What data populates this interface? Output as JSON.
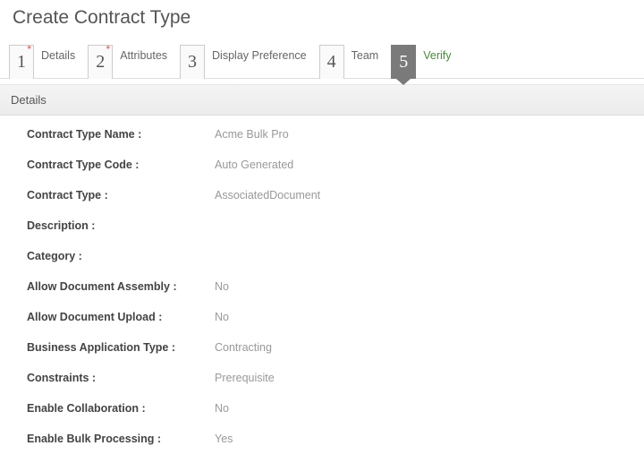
{
  "page": {
    "title": "Create Contract Type"
  },
  "wizard": {
    "active_index": 4,
    "steps": [
      {
        "num": "1",
        "label": "Details",
        "required": true
      },
      {
        "num": "2",
        "label": "Attributes",
        "required": true
      },
      {
        "num": "3",
        "label": "Display Preference",
        "required": false
      },
      {
        "num": "4",
        "label": "Team",
        "required": false
      },
      {
        "num": "5",
        "label": "Verify",
        "required": false
      }
    ]
  },
  "details": {
    "section_title": "Details",
    "rows": [
      {
        "label": "Contract Type Name :",
        "value": "Acme Bulk Pro"
      },
      {
        "label": "Contract Type Code :",
        "value": "Auto Generated"
      },
      {
        "label": "Contract Type :",
        "value": "AssociatedDocument"
      },
      {
        "label": "Description :",
        "value": ""
      },
      {
        "label": "Category :",
        "value": ""
      },
      {
        "label": "Allow Document Assembly :",
        "value": "No"
      },
      {
        "label": "Allow Document Upload :",
        "value": "No"
      },
      {
        "label": "Business Application Type :",
        "value": "Contracting"
      },
      {
        "label": "Constraints :",
        "value": "Prerequisite"
      },
      {
        "label": "Enable Collaboration :",
        "value": "No"
      },
      {
        "label": "Enable Bulk Processing :",
        "value": "Yes"
      }
    ]
  }
}
